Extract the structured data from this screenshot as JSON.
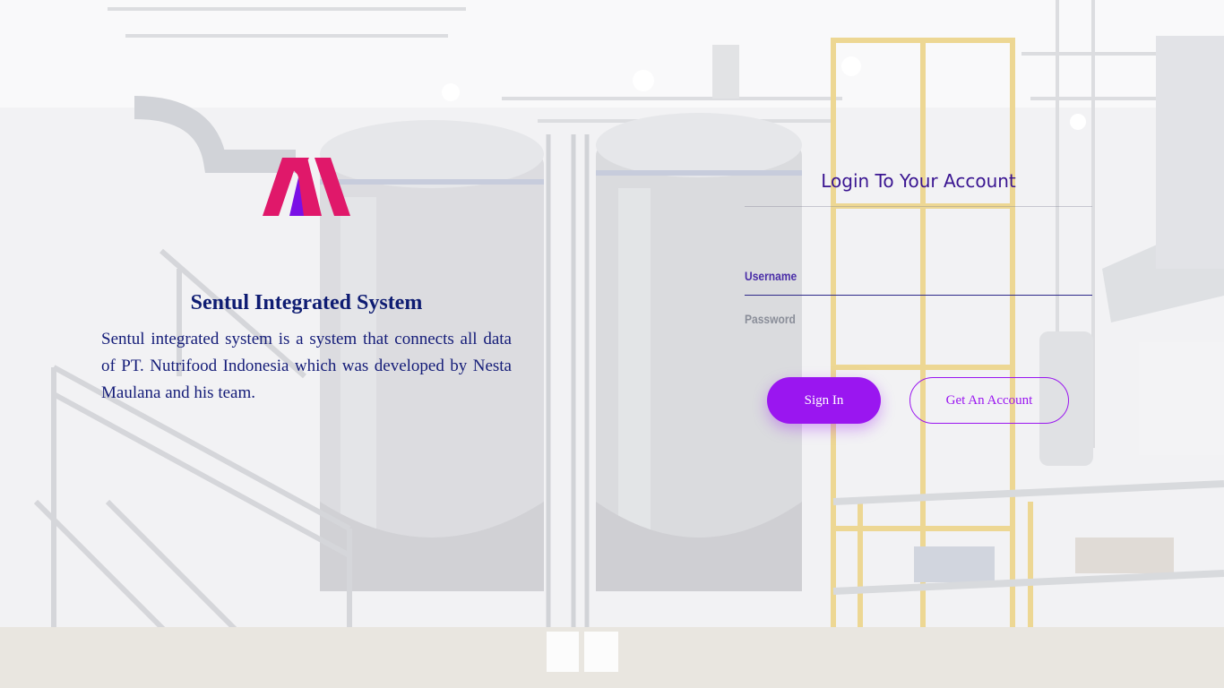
{
  "brand": {
    "title": "Sentul Integrated System",
    "description": "Sentul integrated system is a system that connects all data of PT. Nutrifood Indonesia which was developed by Nesta Maulana and his team.",
    "logo_colors": {
      "primary": "#e0186a",
      "secondary": "#7a10e6"
    }
  },
  "login": {
    "title": "Login To Your Account",
    "username_label": "Username",
    "password_label": "Password",
    "signin_label": "Sign In",
    "get_account_label": "Get An Account"
  },
  "colors": {
    "accent": "#9a16f0",
    "title_blue": "#0e1c72",
    "login_title": "#3a1591"
  }
}
